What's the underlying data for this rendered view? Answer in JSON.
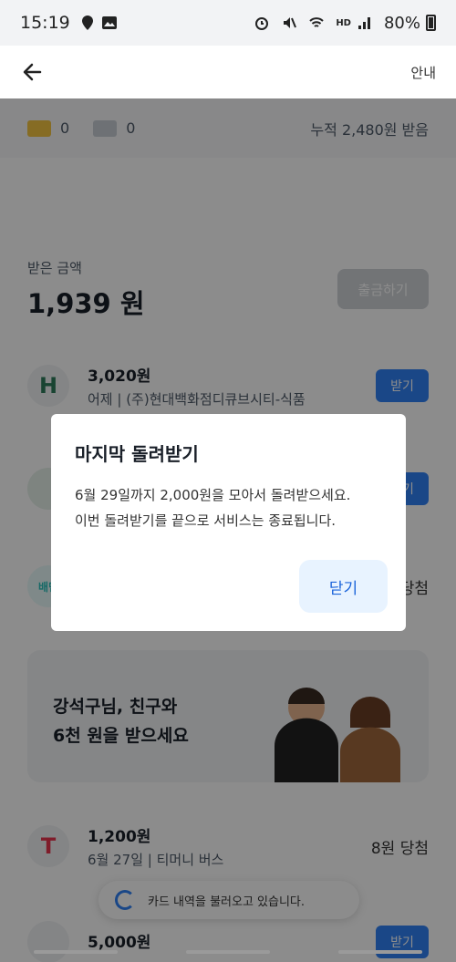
{
  "status_bar": {
    "time": "15:19",
    "battery": "80%",
    "network_label": "HD"
  },
  "app_bar": {
    "guide_label": "안내"
  },
  "summary": {
    "gold_count": "0",
    "gray_count": "0",
    "total_received": "누적 2,480원 받음"
  },
  "received": {
    "label": "받은 금액",
    "amount": "1,939 원",
    "withdraw_label": "출금하기"
  },
  "rows": [
    {
      "logo_text": "H",
      "amount": "3,020원",
      "desc": "어제 | (주)현대백화점디큐브시티-식품",
      "action": "받기"
    },
    {
      "logo_text": "",
      "amount": "",
      "desc": "",
      "action": "받기"
    },
    {
      "logo_text": "배민",
      "amount": "",
      "desc": "",
      "action": "당첨"
    }
  ],
  "promo": {
    "line1": "강석구님, 친구와",
    "line2": "6천 원을 받으세요"
  },
  "rows_bottom": [
    {
      "logo_text": "T",
      "amount": "1,200원",
      "desc": "6월 27일 | 티머니 버스",
      "action": "8원 당첨"
    },
    {
      "logo_text": "",
      "amount": "5,000원",
      "desc": "",
      "action": "받기"
    }
  ],
  "toast": {
    "text": "카드 내역을 불러오고 있습니다."
  },
  "dialog": {
    "title": "마지막 돌려받기",
    "message_line1": "6월 29일까지 2,000원을 모아서 돌려받으세요.",
    "message_line2": "이번 돌려받기를 끝으로 서비스는 종료됩니다.",
    "close_label": "닫기"
  },
  "colors": {
    "accent": "#3182f6",
    "dialog_button_bg": "#e8f3ff",
    "dialog_button_text": "#1b64da"
  }
}
